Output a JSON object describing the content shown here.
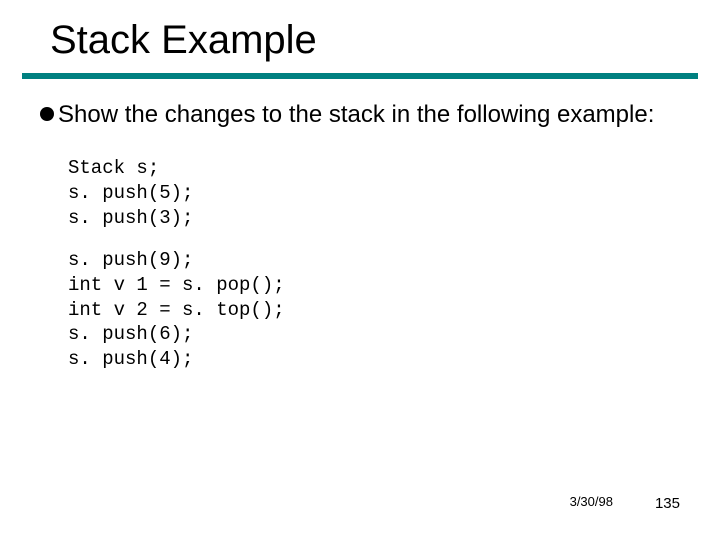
{
  "title": "Stack Example",
  "bullet_text": "Show the changes to the stack in the following example:",
  "code_block_1": "Stack s;\ns. push(5);\ns. push(3);",
  "code_block_2": "s. push(9);\nint v 1 = s. pop();\nint v 2 = s. top();\ns. push(6);\ns. push(4);",
  "footer": {
    "date": "3/30/98",
    "page": "135"
  },
  "colors": {
    "underline": "#008080"
  }
}
